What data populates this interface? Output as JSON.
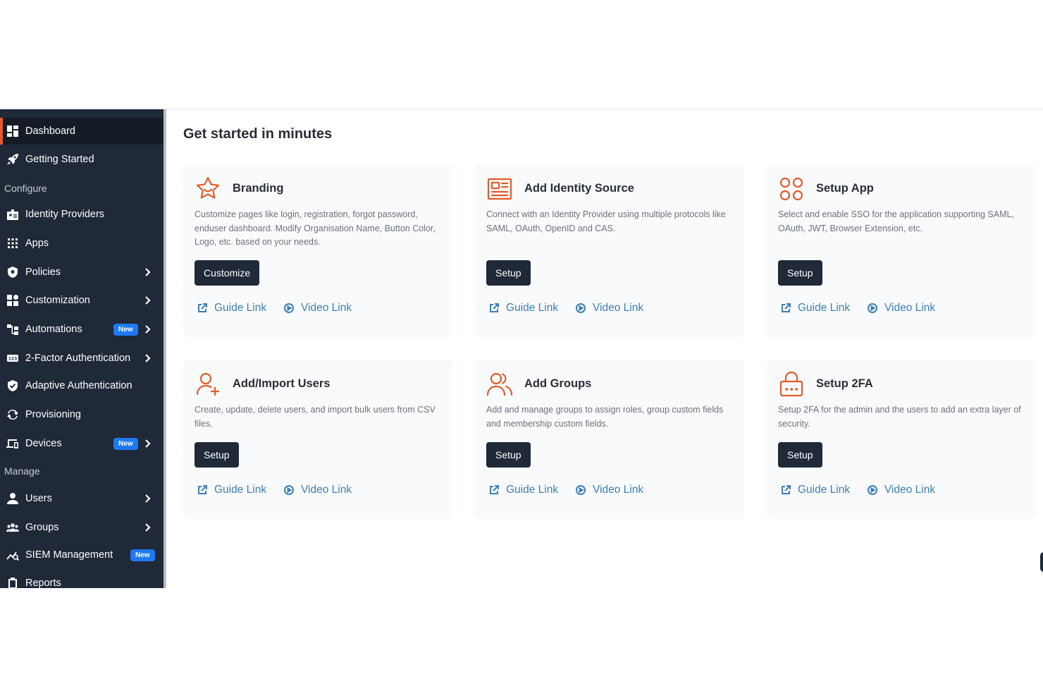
{
  "sidebar": {
    "items": [
      {
        "label": "Dashboard",
        "icon": "dashboard-icon",
        "active": true
      },
      {
        "label": "Getting Started",
        "icon": "rocket-icon"
      },
      {
        "label": "Identity Providers",
        "icon": "id-badge-icon"
      },
      {
        "label": "Apps",
        "icon": "apps-grid-icon"
      },
      {
        "label": "Policies",
        "icon": "shield-icon"
      },
      {
        "label": "Customization",
        "icon": "customize-icon"
      },
      {
        "label": "Automations",
        "icon": "automation-icon",
        "badge": "New"
      },
      {
        "label": "2-Factor Authentication",
        "icon": "keypad-123-icon"
      },
      {
        "label": "Adaptive Authentication",
        "icon": "shield-check-icon"
      },
      {
        "label": "Provisioning",
        "icon": "sync-icon"
      },
      {
        "label": "Devices",
        "icon": "devices-icon",
        "badge": "New"
      },
      {
        "label": "Users",
        "icon": "user-icon"
      },
      {
        "label": "Groups",
        "icon": "groups-icon"
      },
      {
        "label": "SIEM Management",
        "icon": "analytics-icon",
        "badge": "New"
      },
      {
        "label": "Reports",
        "icon": "clipboard-icon"
      }
    ],
    "sections": {
      "configure": "Configure",
      "manage": "Manage"
    }
  },
  "main": {
    "title": "Get started in minutes",
    "cards": [
      {
        "title": "Branding",
        "icon": "star-badge-icon",
        "desc": "Customize pages like login, registration, forgot password, enduser dashboard. Modify Organisation Name, Button Color, Logo, etc. based on your needs.",
        "button": "Customize",
        "guide": "Guide Link",
        "video": "Video Link"
      },
      {
        "title": "Add Identity Source",
        "icon": "id-card-icon",
        "desc": "Connect with an Identity Provider using multiple protocols like SAML, OAuth, OpenID and CAS.",
        "button": "Setup",
        "guide": "Guide Link",
        "video": "Video Link"
      },
      {
        "title": "Setup App",
        "icon": "app-squares-icon",
        "desc": "Select and enable SSO for the application supporting SAML, OAuth, JWT, Browser Extension, etc.",
        "button": "Setup",
        "guide": "Guide Link",
        "video": "Video Link"
      },
      {
        "title": "Add/Import Users",
        "icon": "user-add-icon",
        "desc": "Create, update, delete users, and import bulk users from CSV files.",
        "button": "Setup",
        "guide": "Guide Link",
        "video": "Video Link"
      },
      {
        "title": "Add Groups",
        "icon": "users-group-icon",
        "desc": "Add and manage groups to assign roles, group custom fields and membership custom fields.",
        "button": "Setup",
        "guide": "Guide Link",
        "video": "Video Link"
      },
      {
        "title": "Setup 2FA",
        "icon": "lock-pin-icon",
        "desc": "Setup 2FA for the admin and the users to add an extra layer of security.",
        "button": "Setup",
        "guide": "Guide Link",
        "video": "Video Link"
      }
    ]
  },
  "colors": {
    "sidebar_bg": "#1f2937",
    "accent": "#e35b2c",
    "link": "#3d7fb5",
    "badge": "#1d7af5"
  }
}
